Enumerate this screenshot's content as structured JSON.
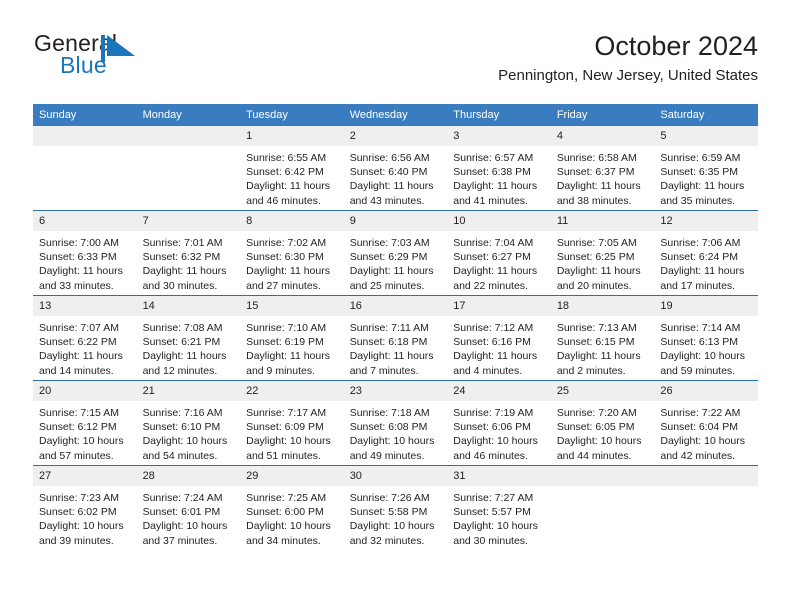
{
  "brand": {
    "name_part1": "General",
    "name_part2": "Blue",
    "logo_color": "#1b75bb"
  },
  "header": {
    "title": "October 2024",
    "location": "Pennington, New Jersey, United States"
  },
  "theme": {
    "header_row_bg": "#3a7cc0",
    "row_divider": "#2e6ead",
    "daynum_bg": "#efefef",
    "text": "#231f20"
  },
  "weekday_headers": [
    "Sunday",
    "Monday",
    "Tuesday",
    "Wednesday",
    "Thursday",
    "Friday",
    "Saturday"
  ],
  "weeks": [
    [
      {
        "day": "",
        "sunrise": "",
        "sunset": "",
        "daylight_line1": "",
        "daylight_line2": ""
      },
      {
        "day": "",
        "sunrise": "",
        "sunset": "",
        "daylight_line1": "",
        "daylight_line2": ""
      },
      {
        "day": "1",
        "sunrise": "Sunrise: 6:55 AM",
        "sunset": "Sunset: 6:42 PM",
        "daylight_line1": "Daylight: 11 hours",
        "daylight_line2": "and 46 minutes."
      },
      {
        "day": "2",
        "sunrise": "Sunrise: 6:56 AM",
        "sunset": "Sunset: 6:40 PM",
        "daylight_line1": "Daylight: 11 hours",
        "daylight_line2": "and 43 minutes."
      },
      {
        "day": "3",
        "sunrise": "Sunrise: 6:57 AM",
        "sunset": "Sunset: 6:38 PM",
        "daylight_line1": "Daylight: 11 hours",
        "daylight_line2": "and 41 minutes."
      },
      {
        "day": "4",
        "sunrise": "Sunrise: 6:58 AM",
        "sunset": "Sunset: 6:37 PM",
        "daylight_line1": "Daylight: 11 hours",
        "daylight_line2": "and 38 minutes."
      },
      {
        "day": "5",
        "sunrise": "Sunrise: 6:59 AM",
        "sunset": "Sunset: 6:35 PM",
        "daylight_line1": "Daylight: 11 hours",
        "daylight_line2": "and 35 minutes."
      }
    ],
    [
      {
        "day": "6",
        "sunrise": "Sunrise: 7:00 AM",
        "sunset": "Sunset: 6:33 PM",
        "daylight_line1": "Daylight: 11 hours",
        "daylight_line2": "and 33 minutes."
      },
      {
        "day": "7",
        "sunrise": "Sunrise: 7:01 AM",
        "sunset": "Sunset: 6:32 PM",
        "daylight_line1": "Daylight: 11 hours",
        "daylight_line2": "and 30 minutes."
      },
      {
        "day": "8",
        "sunrise": "Sunrise: 7:02 AM",
        "sunset": "Sunset: 6:30 PM",
        "daylight_line1": "Daylight: 11 hours",
        "daylight_line2": "and 27 minutes."
      },
      {
        "day": "9",
        "sunrise": "Sunrise: 7:03 AM",
        "sunset": "Sunset: 6:29 PM",
        "daylight_line1": "Daylight: 11 hours",
        "daylight_line2": "and 25 minutes."
      },
      {
        "day": "10",
        "sunrise": "Sunrise: 7:04 AM",
        "sunset": "Sunset: 6:27 PM",
        "daylight_line1": "Daylight: 11 hours",
        "daylight_line2": "and 22 minutes."
      },
      {
        "day": "11",
        "sunrise": "Sunrise: 7:05 AM",
        "sunset": "Sunset: 6:25 PM",
        "daylight_line1": "Daylight: 11 hours",
        "daylight_line2": "and 20 minutes."
      },
      {
        "day": "12",
        "sunrise": "Sunrise: 7:06 AM",
        "sunset": "Sunset: 6:24 PM",
        "daylight_line1": "Daylight: 11 hours",
        "daylight_line2": "and 17 minutes."
      }
    ],
    [
      {
        "day": "13",
        "sunrise": "Sunrise: 7:07 AM",
        "sunset": "Sunset: 6:22 PM",
        "daylight_line1": "Daylight: 11 hours",
        "daylight_line2": "and 14 minutes."
      },
      {
        "day": "14",
        "sunrise": "Sunrise: 7:08 AM",
        "sunset": "Sunset: 6:21 PM",
        "daylight_line1": "Daylight: 11 hours",
        "daylight_line2": "and 12 minutes."
      },
      {
        "day": "15",
        "sunrise": "Sunrise: 7:10 AM",
        "sunset": "Sunset: 6:19 PM",
        "daylight_line1": "Daylight: 11 hours",
        "daylight_line2": "and 9 minutes."
      },
      {
        "day": "16",
        "sunrise": "Sunrise: 7:11 AM",
        "sunset": "Sunset: 6:18 PM",
        "daylight_line1": "Daylight: 11 hours",
        "daylight_line2": "and 7 minutes."
      },
      {
        "day": "17",
        "sunrise": "Sunrise: 7:12 AM",
        "sunset": "Sunset: 6:16 PM",
        "daylight_line1": "Daylight: 11 hours",
        "daylight_line2": "and 4 minutes."
      },
      {
        "day": "18",
        "sunrise": "Sunrise: 7:13 AM",
        "sunset": "Sunset: 6:15 PM",
        "daylight_line1": "Daylight: 11 hours",
        "daylight_line2": "and 2 minutes."
      },
      {
        "day": "19",
        "sunrise": "Sunrise: 7:14 AM",
        "sunset": "Sunset: 6:13 PM",
        "daylight_line1": "Daylight: 10 hours",
        "daylight_line2": "and 59 minutes."
      }
    ],
    [
      {
        "day": "20",
        "sunrise": "Sunrise: 7:15 AM",
        "sunset": "Sunset: 6:12 PM",
        "daylight_line1": "Daylight: 10 hours",
        "daylight_line2": "and 57 minutes."
      },
      {
        "day": "21",
        "sunrise": "Sunrise: 7:16 AM",
        "sunset": "Sunset: 6:10 PM",
        "daylight_line1": "Daylight: 10 hours",
        "daylight_line2": "and 54 minutes."
      },
      {
        "day": "22",
        "sunrise": "Sunrise: 7:17 AM",
        "sunset": "Sunset: 6:09 PM",
        "daylight_line1": "Daylight: 10 hours",
        "daylight_line2": "and 51 minutes."
      },
      {
        "day": "23",
        "sunrise": "Sunrise: 7:18 AM",
        "sunset": "Sunset: 6:08 PM",
        "daylight_line1": "Daylight: 10 hours",
        "daylight_line2": "and 49 minutes."
      },
      {
        "day": "24",
        "sunrise": "Sunrise: 7:19 AM",
        "sunset": "Sunset: 6:06 PM",
        "daylight_line1": "Daylight: 10 hours",
        "daylight_line2": "and 46 minutes."
      },
      {
        "day": "25",
        "sunrise": "Sunrise: 7:20 AM",
        "sunset": "Sunset: 6:05 PM",
        "daylight_line1": "Daylight: 10 hours",
        "daylight_line2": "and 44 minutes."
      },
      {
        "day": "26",
        "sunrise": "Sunrise: 7:22 AM",
        "sunset": "Sunset: 6:04 PM",
        "daylight_line1": "Daylight: 10 hours",
        "daylight_line2": "and 42 minutes."
      }
    ],
    [
      {
        "day": "27",
        "sunrise": "Sunrise: 7:23 AM",
        "sunset": "Sunset: 6:02 PM",
        "daylight_line1": "Daylight: 10 hours",
        "daylight_line2": "and 39 minutes."
      },
      {
        "day": "28",
        "sunrise": "Sunrise: 7:24 AM",
        "sunset": "Sunset: 6:01 PM",
        "daylight_line1": "Daylight: 10 hours",
        "daylight_line2": "and 37 minutes."
      },
      {
        "day": "29",
        "sunrise": "Sunrise: 7:25 AM",
        "sunset": "Sunset: 6:00 PM",
        "daylight_line1": "Daylight: 10 hours",
        "daylight_line2": "and 34 minutes."
      },
      {
        "day": "30",
        "sunrise": "Sunrise: 7:26 AM",
        "sunset": "Sunset: 5:58 PM",
        "daylight_line1": "Daylight: 10 hours",
        "daylight_line2": "and 32 minutes."
      },
      {
        "day": "31",
        "sunrise": "Sunrise: 7:27 AM",
        "sunset": "Sunset: 5:57 PM",
        "daylight_line1": "Daylight: 10 hours",
        "daylight_line2": "and 30 minutes."
      },
      {
        "day": "",
        "sunrise": "",
        "sunset": "",
        "daylight_line1": "",
        "daylight_line2": ""
      },
      {
        "day": "",
        "sunrise": "",
        "sunset": "",
        "daylight_line1": "",
        "daylight_line2": ""
      }
    ]
  ]
}
